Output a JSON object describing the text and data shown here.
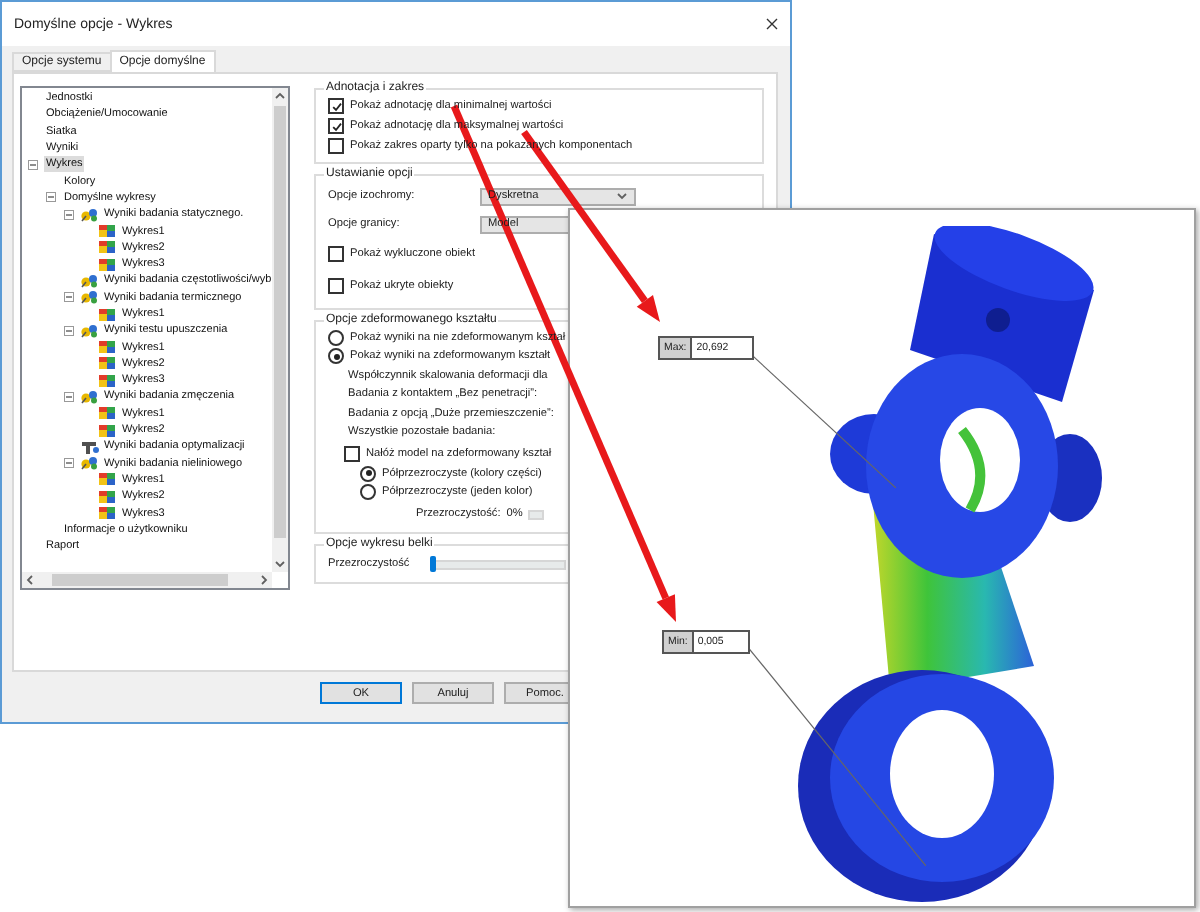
{
  "window": {
    "title": "Domyślne opcje - Wykres"
  },
  "tabs": [
    {
      "label": "Opcje systemu",
      "selected": false
    },
    {
      "label": "Opcje domyślne",
      "selected": true
    }
  ],
  "tree": {
    "items": [
      {
        "label": "Jednostki",
        "selected": false
      },
      {
        "label": "Obciążenie/Umocowanie",
        "selected": false
      },
      {
        "label": "Siatka",
        "selected": false
      },
      {
        "label": "Wyniki",
        "selected": false
      },
      {
        "label": "Wykres",
        "selected": true,
        "expanded": true,
        "children": [
          {
            "label": "Kolory",
            "selected": false
          },
          {
            "label": "Domyślne wykresy",
            "selected": false,
            "expanded": true,
            "children": [
              {
                "label": "Wyniki badania statycznego.",
                "kind": "study",
                "selected": false,
                "expanded": true,
                "children": [
                  {
                    "label": "Wykres1",
                    "kind": "plot",
                    "selected": false
                  },
                  {
                    "label": "Wykres2",
                    "kind": "plot",
                    "selected": false
                  },
                  {
                    "label": "Wykres3",
                    "kind": "plot",
                    "selected": false
                  }
                ]
              },
              {
                "label": "Wyniki badania częstotliwości/wyb",
                "kind": "study",
                "selected": false
              },
              {
                "label": "Wyniki badania termicznego",
                "kind": "study",
                "selected": false,
                "expanded": true,
                "children": [
                  {
                    "label": "Wykres1",
                    "kind": "plot",
                    "selected": false
                  }
                ]
              },
              {
                "label": "Wyniki testu upuszczenia",
                "kind": "study",
                "selected": false,
                "expanded": true,
                "children": [
                  {
                    "label": "Wykres1",
                    "kind": "plot",
                    "selected": false
                  },
                  {
                    "label": "Wykres2",
                    "kind": "plot",
                    "selected": false
                  },
                  {
                    "label": "Wykres3",
                    "kind": "plot",
                    "selected": false
                  }
                ]
              },
              {
                "label": "Wyniki badania zmęczenia",
                "kind": "study",
                "selected": false,
                "expanded": true,
                "children": [
                  {
                    "label": "Wykres1",
                    "kind": "plot",
                    "selected": false
                  },
                  {
                    "label": "Wykres2",
                    "kind": "plot",
                    "selected": false
                  }
                ]
              },
              {
                "label": "Wyniki badania optymalizacji",
                "kind": "optimization",
                "selected": false
              },
              {
                "label": "Wyniki badania nieliniowego",
                "kind": "study",
                "selected": false,
                "expanded": true,
                "children": [
                  {
                    "label": "Wykres1",
                    "kind": "plot",
                    "selected": false
                  },
                  {
                    "label": "Wykres2",
                    "kind": "plot",
                    "selected": false
                  },
                  {
                    "label": "Wykres3",
                    "kind": "plot",
                    "selected": false
                  }
                ]
              }
            ]
          },
          {
            "label": "Informacje o użytkowniku",
            "selected": false
          }
        ]
      },
      {
        "label": "Raport",
        "selected": false
      }
    ]
  },
  "annotation_group": {
    "title": "Adnotacja i zakres",
    "options": [
      {
        "label": "Pokaż adnotację dla minimalnej wartości",
        "checked": true
      },
      {
        "label": "Pokaż adnotację dla maksymalnej wartości",
        "checked": true
      },
      {
        "label": "Pokaż zakres oparty tylko na pokazanych komponentach",
        "checked": false
      }
    ]
  },
  "options_group": {
    "title": "Ustawianie opcji",
    "fields": [
      {
        "label": "Opcje izochromy:",
        "value": "Dyskretna"
      },
      {
        "label": "Opcje granicy:",
        "value": "Model"
      }
    ],
    "checkboxes": [
      {
        "label": "Pokaż wykluczone obiekt",
        "checked": false
      },
      {
        "label": "Pokaż ukryte obiekty",
        "checked": false
      }
    ]
  },
  "deformed_group": {
    "title": "Opcje zdeformowanego kształtu",
    "items": [
      {
        "kind": "radio",
        "label": "Pokaż wyniki na nie zdeformowanym kształ",
        "selected": false
      },
      {
        "kind": "radio",
        "label": "Pokaż wyniki na zdeformowanym kształt",
        "selected": true
      },
      {
        "kind": "text",
        "label": "Współczynnik skalowania deformacji dla"
      },
      {
        "kind": "text",
        "label": "Badania z kontaktem „Bez penetracji”:"
      },
      {
        "kind": "text",
        "label": "Badania z opcją „Duże przemieszczenie”:"
      },
      {
        "kind": "text",
        "label": "Wszystkie pozostałe badania:"
      },
      {
        "kind": "checkbox",
        "label": "Nałóż model na zdeformowany kształ",
        "checked": false,
        "children": [
          {
            "kind": "radio",
            "label": "Półprzezroczyste (kolory części)",
            "selected": true
          },
          {
            "kind": "radio",
            "label": "Półprzezroczyste (jeden kolor)",
            "selected": false
          },
          {
            "kind": "slider",
            "label": "Przezroczystość:",
            "reading": "0%"
          }
        ]
      }
    ]
  },
  "beam_group": {
    "title": "Opcje wykresu belki",
    "slider": {
      "label": "Przezroczystość",
      "level": 0
    }
  },
  "buttons": [
    {
      "label": "OK",
      "default": true
    },
    {
      "label": "Anuluj",
      "default": false
    },
    {
      "label": "Pomoc.",
      "default": false
    }
  ],
  "result_view": {
    "annotations": [
      {
        "kind": "max",
        "label": "Max:",
        "value": "20,692"
      },
      {
        "kind": "min",
        "label": "Min:",
        "value": "0,005"
      }
    ]
  }
}
